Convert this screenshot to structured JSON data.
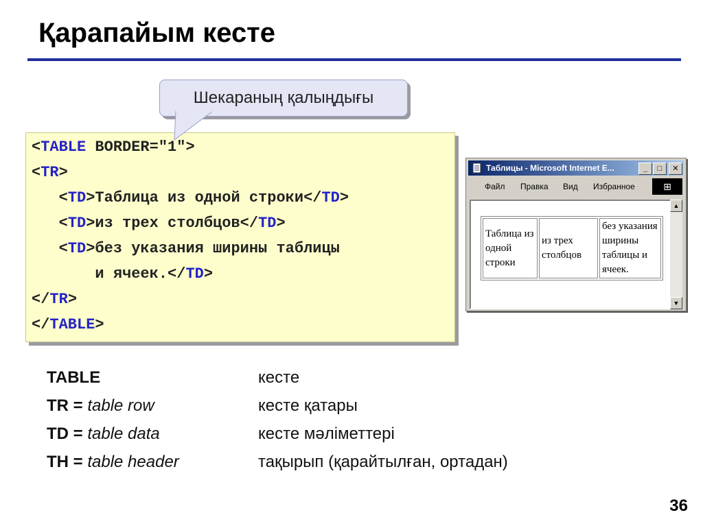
{
  "slide": {
    "title": "Қарапайым кесте",
    "page_number": "36"
  },
  "callout": {
    "text": "Шекараның қалыңдығы"
  },
  "code": {
    "lines": [
      {
        "pre": "",
        "tag_open": "<",
        "tag": "TABLE",
        "rest": " BORDER=\"1\">"
      },
      {
        "pre": "",
        "tag_open": "<",
        "tag": "TR",
        "rest": ">"
      },
      {
        "pre": "   ",
        "open": "<",
        "tag1": "TD",
        "mid": ">Таблица из одной строки</",
        "tag2": "TD",
        "close": ">"
      },
      {
        "pre": "   ",
        "open": "<",
        "tag1": "TD",
        "mid": ">из трех столбцов</",
        "tag2": "TD",
        "close": ">"
      },
      {
        "pre": "   ",
        "open": "<",
        "tag1": "TD",
        "mid": ">без указания ширины таблицы"
      },
      {
        "pre": "       ",
        "mid": "и ячеек.</",
        "tag2": "TD",
        "close": ">"
      },
      {
        "pre": "",
        "open": "</",
        "tag1": "TR",
        "close": ">"
      },
      {
        "pre": "",
        "open": "</",
        "tag1": "TABLE",
        "close": ">"
      }
    ]
  },
  "browser": {
    "title": "Таблицы - Microsoft Internet E...",
    "menu": [
      "Файл",
      "Правка",
      "Вид",
      "Избранное"
    ],
    "window_buttons": {
      "minimize": "_",
      "maximize": "□",
      "close": "✕"
    },
    "table_cells": [
      "Таблица из одной строки",
      "из трех столбцов",
      "без указания ширины таблицы и ячеек."
    ]
  },
  "glossary": [
    {
      "term": "TABLE",
      "expansion": "",
      "definition": "кесте"
    },
    {
      "term": "TR = ",
      "expansion": "table row",
      "definition": "кесте қатары"
    },
    {
      "term": "TD = ",
      "expansion": "table data",
      "definition": "кесте мәліметтері"
    },
    {
      "term": "TH = ",
      "expansion": "table header",
      "definition": "тақырып (қарайтылған, ортадан)"
    }
  ],
  "colors": {
    "accent_rule": "#1f2f9a",
    "code_background": "#fefecc",
    "tag_color": "#2323c8",
    "callout_background": "#e4e6f6"
  }
}
